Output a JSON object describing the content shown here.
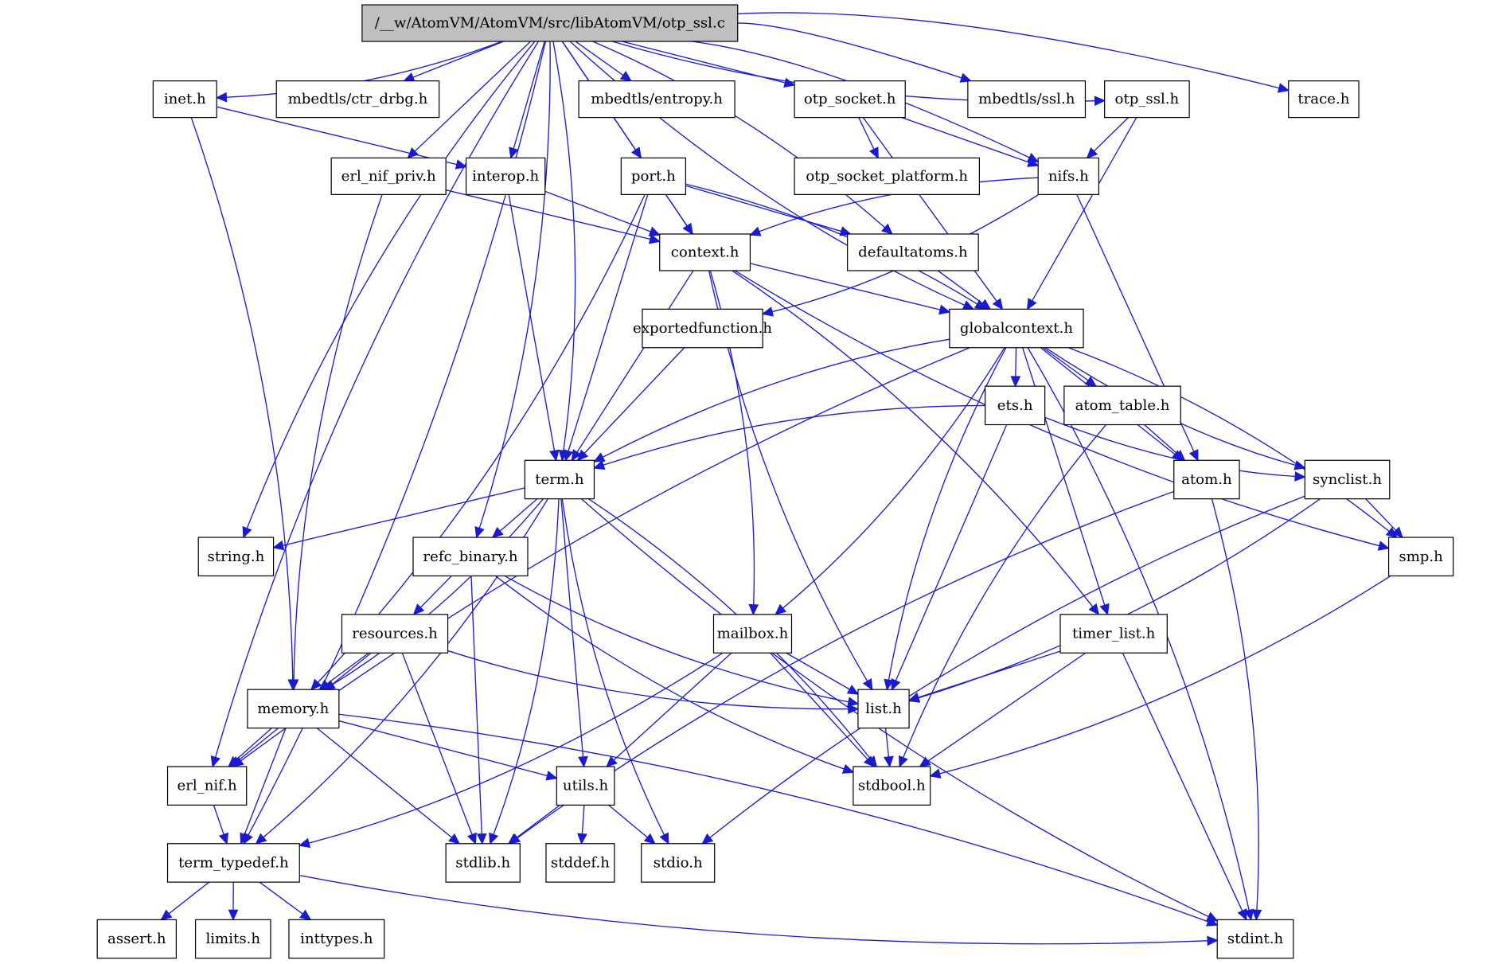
{
  "title": "/__w/AtomVM/AtomVM/src/libAtomVM/otp_ssl.c",
  "colors": {
    "edge": "#1a1ad0",
    "root_fill": "#bfbfbf",
    "node_fill": "#ffffff",
    "node_stroke": "#000000"
  },
  "nodes": [
    {
      "id": "otp_ssl_c",
      "label": "/__w/AtomVM/AtomVM/src/libAtomVM/otp_ssl.c",
      "root": true
    },
    {
      "id": "inet_h",
      "label": "inet.h"
    },
    {
      "id": "ctr_drbg_h",
      "label": "mbedtls/ctr_drbg.h"
    },
    {
      "id": "entropy_h",
      "label": "mbedtls/entropy.h"
    },
    {
      "id": "otp_socket_h",
      "label": "otp_socket.h"
    },
    {
      "id": "mbedtls_ssl_h",
      "label": "mbedtls/ssl.h"
    },
    {
      "id": "otp_ssl_h",
      "label": "otp_ssl.h"
    },
    {
      "id": "trace_h",
      "label": "trace.h"
    },
    {
      "id": "erl_nif_priv_h",
      "label": "erl_nif_priv.h"
    },
    {
      "id": "interop_h",
      "label": "interop.h"
    },
    {
      "id": "port_h",
      "label": "port.h"
    },
    {
      "id": "otp_socket_platform_h",
      "label": "otp_socket_platform.h"
    },
    {
      "id": "nifs_h",
      "label": "nifs.h"
    },
    {
      "id": "context_h",
      "label": "context.h"
    },
    {
      "id": "defaultatoms_h",
      "label": "defaultatoms.h"
    },
    {
      "id": "exportedfunction_h",
      "label": "exportedfunction.h"
    },
    {
      "id": "globalcontext_h",
      "label": "globalcontext.h"
    },
    {
      "id": "ets_h",
      "label": "ets.h"
    },
    {
      "id": "atom_table_h",
      "label": "atom_table.h"
    },
    {
      "id": "term_h",
      "label": "term.h"
    },
    {
      "id": "atom_h",
      "label": "atom.h"
    },
    {
      "id": "synclist_h",
      "label": "synclist.h"
    },
    {
      "id": "string_h",
      "label": "string.h"
    },
    {
      "id": "refc_binary_h",
      "label": "refc_binary.h"
    },
    {
      "id": "smp_h",
      "label": "smp.h"
    },
    {
      "id": "resources_h",
      "label": "resources.h"
    },
    {
      "id": "mailbox_h",
      "label": "mailbox.h"
    },
    {
      "id": "timer_list_h",
      "label": "timer_list.h"
    },
    {
      "id": "memory_h",
      "label": "memory.h"
    },
    {
      "id": "list_h",
      "label": "list.h"
    },
    {
      "id": "erl_nif_h",
      "label": "erl_nif.h"
    },
    {
      "id": "utils_h",
      "label": "utils.h"
    },
    {
      "id": "stdbool_h",
      "label": "stdbool.h"
    },
    {
      "id": "term_typedef_h",
      "label": "term_typedef.h"
    },
    {
      "id": "stdlib_h",
      "label": "stdlib.h"
    },
    {
      "id": "stddef_h",
      "label": "stddef.h"
    },
    {
      "id": "stdio_h",
      "label": "stdio.h"
    },
    {
      "id": "assert_h",
      "label": "assert.h"
    },
    {
      "id": "limits_h",
      "label": "limits.h"
    },
    {
      "id": "inttypes_h",
      "label": "inttypes.h"
    },
    {
      "id": "stdint_h",
      "label": "stdint.h"
    }
  ],
  "edges": [
    [
      "otp_ssl_c",
      "inet_h"
    ],
    [
      "otp_ssl_c",
      "ctr_drbg_h"
    ],
    [
      "otp_ssl_c",
      "entropy_h"
    ],
    [
      "otp_ssl_c",
      "otp_socket_h"
    ],
    [
      "otp_ssl_c",
      "mbedtls_ssl_h"
    ],
    [
      "otp_ssl_c",
      "otp_ssl_h"
    ],
    [
      "otp_ssl_c",
      "trace_h"
    ],
    [
      "otp_ssl_c",
      "erl_nif_priv_h"
    ],
    [
      "otp_ssl_c",
      "interop_h"
    ],
    [
      "otp_ssl_c",
      "port_h"
    ],
    [
      "otp_ssl_c",
      "nifs_h"
    ],
    [
      "otp_ssl_c",
      "context_h"
    ],
    [
      "otp_ssl_c",
      "defaultatoms_h"
    ],
    [
      "otp_ssl_c",
      "globalcontext_h"
    ],
    [
      "otp_ssl_c",
      "term_h"
    ],
    [
      "otp_ssl_c",
      "string_h"
    ],
    [
      "otp_ssl_c",
      "refc_binary_h"
    ],
    [
      "otp_ssl_c",
      "erl_nif_h"
    ],
    [
      "otp_ssl_c",
      "term_typedef_h"
    ],
    [
      "inet_h",
      "interop_h"
    ],
    [
      "inet_h",
      "memory_h"
    ],
    [
      "otp_socket_h",
      "otp_socket_platform_h"
    ],
    [
      "otp_socket_h",
      "nifs_h"
    ],
    [
      "otp_socket_h",
      "globalcontext_h"
    ],
    [
      "otp_ssl_h",
      "nifs_h"
    ],
    [
      "otp_ssl_h",
      "globalcontext_h"
    ],
    [
      "erl_nif_priv_h",
      "context_h"
    ],
    [
      "erl_nif_priv_h",
      "memory_h"
    ],
    [
      "interop_h",
      "context_h"
    ],
    [
      "interop_h",
      "term_h"
    ],
    [
      "port_h",
      "context_h"
    ],
    [
      "port_h",
      "defaultatoms_h"
    ],
    [
      "port_h",
      "globalcontext_h"
    ],
    [
      "port_h",
      "term_h"
    ],
    [
      "port_h",
      "memory_h"
    ],
    [
      "nifs_h",
      "context_h"
    ],
    [
      "nifs_h",
      "exportedfunction_h"
    ],
    [
      "nifs_h",
      "atom_h"
    ],
    [
      "context_h",
      "globalcontext_h"
    ],
    [
      "context_h",
      "term_h"
    ],
    [
      "context_h",
      "mailbox_h"
    ],
    [
      "context_h",
      "list_h"
    ],
    [
      "context_h",
      "timer_list_h"
    ],
    [
      "context_h",
      "smp_h"
    ],
    [
      "defaultatoms_h",
      "globalcontext_h"
    ],
    [
      "exportedfunction_h",
      "term_h"
    ],
    [
      "globalcontext_h",
      "ets_h"
    ],
    [
      "globalcontext_h",
      "atom_table_h"
    ],
    [
      "globalcontext_h",
      "atom_h"
    ],
    [
      "globalcontext_h",
      "synclist_h"
    ],
    [
      "globalcontext_h",
      "smp_h"
    ],
    [
      "globalcontext_h",
      "term_h"
    ],
    [
      "globalcontext_h",
      "mailbox_h"
    ],
    [
      "globalcontext_h",
      "list_h"
    ],
    [
      "globalcontext_h",
      "timer_list_h"
    ],
    [
      "globalcontext_h",
      "erl_nif_h"
    ],
    [
      "globalcontext_h",
      "stdint_h"
    ],
    [
      "ets_h",
      "term_h"
    ],
    [
      "ets_h",
      "list_h"
    ],
    [
      "ets_h",
      "synclist_h"
    ],
    [
      "atom_table_h",
      "atom_h"
    ],
    [
      "atom_table_h",
      "stdbool_h"
    ],
    [
      "term_h",
      "string_h"
    ],
    [
      "term_h",
      "refc_binary_h"
    ],
    [
      "term_h",
      "memory_h"
    ],
    [
      "term_h",
      "utils_h"
    ],
    [
      "term_h",
      "stdlib_h"
    ],
    [
      "term_h",
      "stdio_h"
    ],
    [
      "term_h",
      "stdbool_h"
    ],
    [
      "term_h",
      "stdint_h"
    ],
    [
      "term_h",
      "term_typedef_h"
    ],
    [
      "atom_h",
      "stdlib_h"
    ],
    [
      "atom_h",
      "stdint_h"
    ],
    [
      "synclist_h",
      "smp_h"
    ],
    [
      "synclist_h",
      "list_h"
    ],
    [
      "synclist_h",
      "stdio_h"
    ],
    [
      "refc_binary_h",
      "resources_h"
    ],
    [
      "refc_binary_h",
      "list_h"
    ],
    [
      "refc_binary_h",
      "stdlib_h"
    ],
    [
      "refc_binary_h",
      "stdbool_h"
    ],
    [
      "smp_h",
      "stdbool_h"
    ],
    [
      "resources_h",
      "memory_h"
    ],
    [
      "resources_h",
      "erl_nif_h"
    ],
    [
      "resources_h",
      "list_h"
    ],
    [
      "resources_h",
      "stdlib_h"
    ],
    [
      "mailbox_h",
      "list_h"
    ],
    [
      "mailbox_h",
      "utils_h"
    ],
    [
      "mailbox_h",
      "stdbool_h"
    ],
    [
      "mailbox_h",
      "term_typedef_h"
    ],
    [
      "timer_list_h",
      "list_h"
    ],
    [
      "timer_list_h",
      "stdbool_h"
    ],
    [
      "timer_list_h",
      "stdint_h"
    ],
    [
      "memory_h",
      "erl_nif_h"
    ],
    [
      "memory_h",
      "utils_h"
    ],
    [
      "memory_h",
      "stdlib_h"
    ],
    [
      "memory_h",
      "term_typedef_h"
    ],
    [
      "memory_h",
      "stdint_h"
    ],
    [
      "list_h",
      "stdbool_h"
    ],
    [
      "erl_nif_h",
      "term_typedef_h"
    ],
    [
      "utils_h",
      "stdlib_h"
    ],
    [
      "utils_h",
      "stddef_h"
    ],
    [
      "utils_h",
      "stdio_h"
    ],
    [
      "term_typedef_h",
      "assert_h"
    ],
    [
      "term_typedef_h",
      "limits_h"
    ],
    [
      "term_typedef_h",
      "inttypes_h"
    ],
    [
      "term_typedef_h",
      "stdint_h"
    ]
  ]
}
